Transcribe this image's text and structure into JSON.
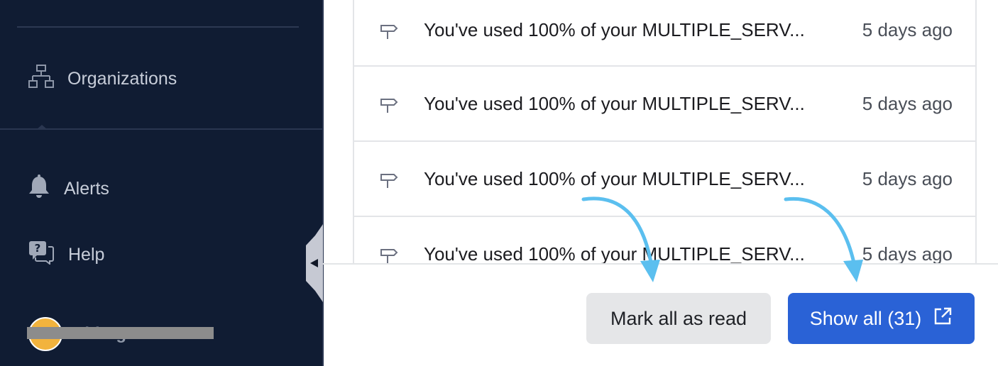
{
  "sidebar": {
    "organizations_label": "Organizations",
    "alerts_label": "Alerts",
    "help_label": "Help",
    "user_name": "Chirag"
  },
  "notifications": [
    {
      "text": "You've used 100% of your MULTIPLE_SERV...",
      "time": "5 days ago",
      "icon": "signpost-icon"
    },
    {
      "text": "You've used 100% of your MULTIPLE_SERV...",
      "time": "5 days ago",
      "icon": "signpost-icon"
    },
    {
      "text": "You've used 100% of your MULTIPLE_SERV...",
      "time": "5 days ago",
      "icon": "signpost-icon"
    },
    {
      "text": "You've used 100% of your MULTIPLE_SERV...",
      "time": "5 days ago",
      "icon": "signpost-icon"
    }
  ],
  "actions": {
    "mark_all_label": "Mark all as read",
    "show_all_label": "Show all (31)"
  },
  "colors": {
    "sidebar_bg": "#101c33",
    "primary": "#2a62d6",
    "annotation_arrow": "#5bbfef"
  }
}
